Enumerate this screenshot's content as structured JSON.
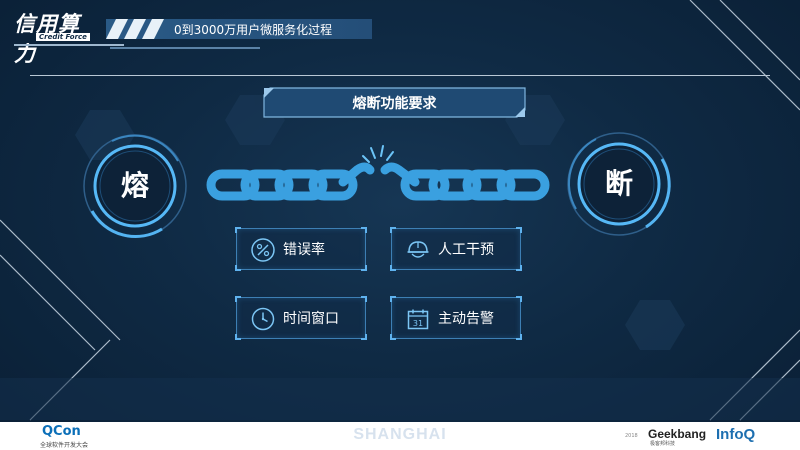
{
  "brand": {
    "logo_text": "信用算力",
    "logo_subtext": "Credit Force"
  },
  "header": {
    "title": "0到3000万用户微服务化过程"
  },
  "section": {
    "title": "熔断功能要求"
  },
  "circles": {
    "left_char": "熔",
    "right_char": "断"
  },
  "features": [
    {
      "label": "错误率",
      "icon": "percent-icon"
    },
    {
      "label": "人工干预",
      "icon": "worker-helmet-icon"
    },
    {
      "label": "时间窗口",
      "icon": "clock-icon"
    },
    {
      "label": "主动告警",
      "icon": "calendar-icon",
      "icon_text": "31"
    }
  ],
  "footer": {
    "qcon": "QCon",
    "qcon_sub": "全球软件开发大会",
    "city": "SHANGHAI",
    "geek_prefix": "2018",
    "geekbang": "Geekbang",
    "geekbang_sub": "极客邦科技",
    "infoq": "InfoQ"
  },
  "colors": {
    "background": "#0f2a44",
    "accent": "#3fa6e6",
    "chain": "#3aa0e0",
    "border": "#3d7fb4"
  }
}
